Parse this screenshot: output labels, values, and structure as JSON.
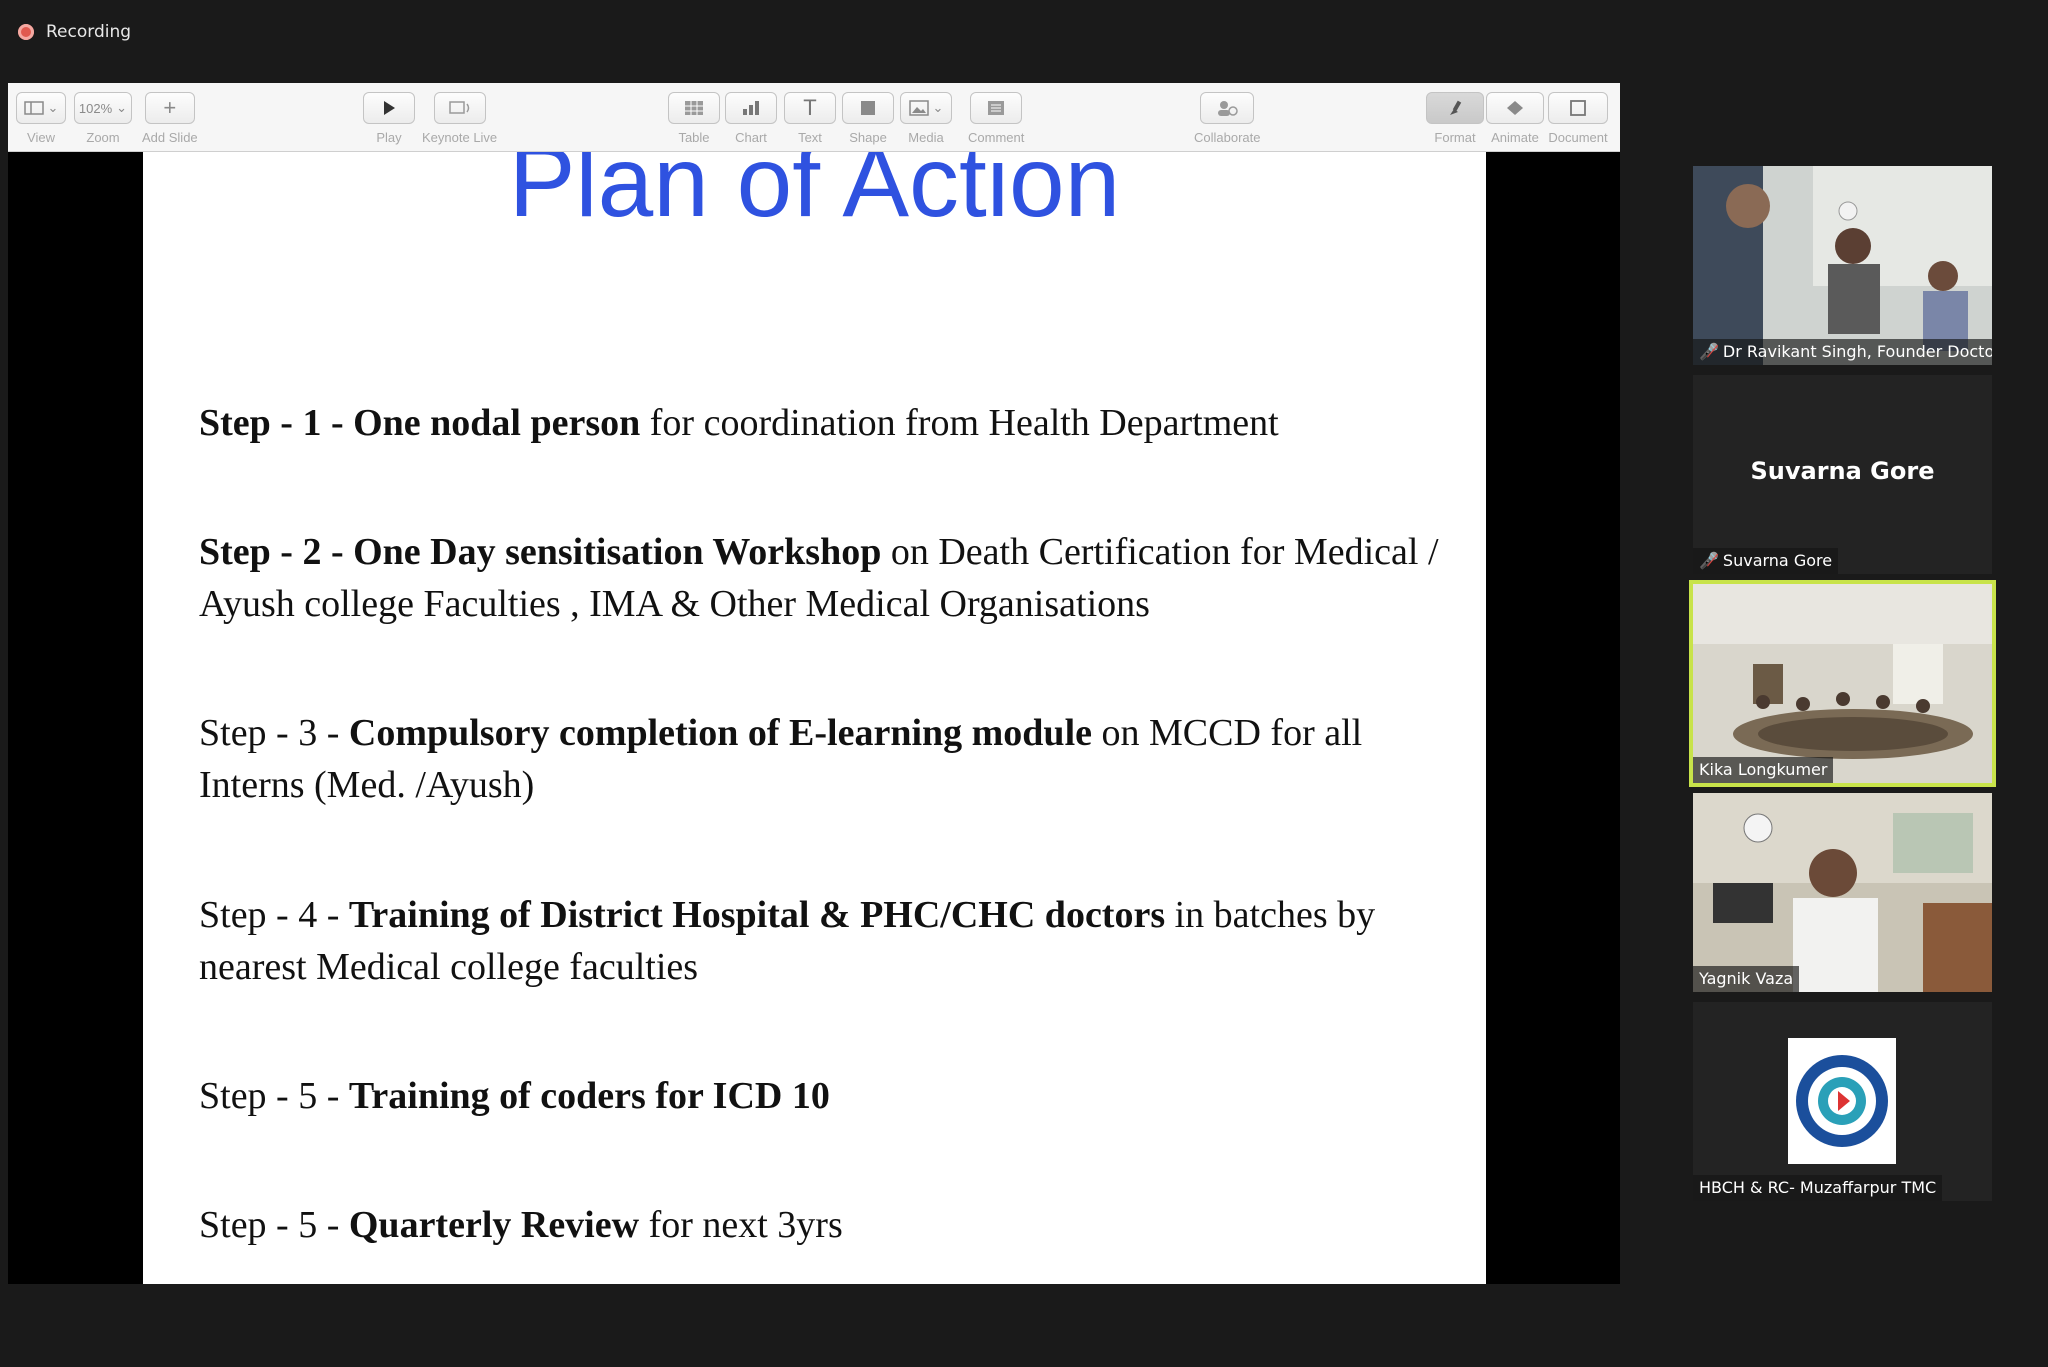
{
  "recording": {
    "label": "Recording"
  },
  "toolbar": {
    "view": "View",
    "zoom": "Zoom",
    "zoom_value": "102%",
    "add_slide": "Add Slide",
    "play": "Play",
    "keynote_live": "Keynote Live",
    "table": "Table",
    "chart": "Chart",
    "text": "Text",
    "shape": "Shape",
    "media": "Media",
    "comment": "Comment",
    "collaborate": "Collaborate",
    "format": "Format",
    "animate": "Animate",
    "document": "Document"
  },
  "slide": {
    "title": "Plan of Action",
    "steps": [
      {
        "prefix": "Step - 1 - One nodal person",
        "rest": " for coordination from Health Department",
        "prefix_bold": true
      },
      {
        "prefix": "Step - 2 - One Day sensitisation Workshop",
        "rest": " on Death Certification for Medical / Ayush college Faculties , IMA & Other Medical Organisations",
        "prefix_bold": true
      },
      {
        "lead": "Step - 3 - ",
        "bold": "Compulsory completion of E-learning module",
        "rest": " on MCCD for all Interns (Med. /Ayush)"
      },
      {
        "lead": "Step - 4 - ",
        "bold": "Training of District Hospital & PHC/CHC doctors",
        "rest": " in batches by nearest Medical college faculties"
      },
      {
        "lead": "Step - 5 - ",
        "bold": "Training of coders for ICD 10",
        "rest": ""
      },
      {
        "lead": "Step - 5 - ",
        "bold": "Quarterly Review",
        "rest": " for next 3yrs"
      }
    ]
  },
  "participants": [
    {
      "name": "Dr Ravikant Singh, Founder Docto...",
      "muted": true
    },
    {
      "name": "Suvarna Gore",
      "display_name": "Suvarna Gore",
      "muted": true
    },
    {
      "name": "Kika Longkumer",
      "muted": false,
      "active_speaker": true
    },
    {
      "name": "Yagnik Vaza",
      "muted": false
    },
    {
      "name": "HBCH & RC- Muzaffarpur TMC",
      "muted": false
    }
  ],
  "colors": {
    "title_blue": "#2f52e0",
    "active_border": "#c8e34a",
    "mute_red": "#e0403a"
  }
}
